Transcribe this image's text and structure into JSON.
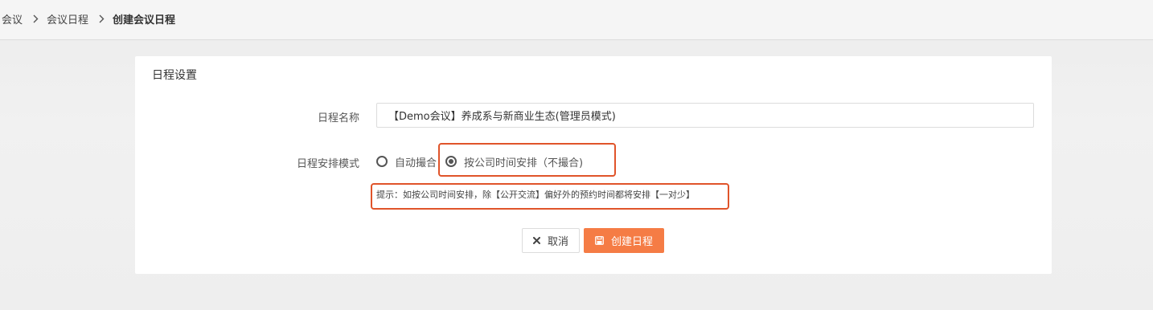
{
  "breadcrumb": {
    "items": [
      "会议",
      "会议日程",
      "创建会议日程"
    ]
  },
  "card": {
    "title": "日程设置"
  },
  "form": {
    "name_label": "日程名称",
    "name_value": "【Demo会议】养成系与新商业生态(管理员模式)",
    "mode_label": "日程安排模式",
    "mode_options": [
      {
        "label": "自动撮合",
        "checked": false
      },
      {
        "label": "按公司时间安排（不撮合)",
        "checked": true
      }
    ],
    "hint": "提示：如按公司时间安排，除【公开交流】偏好外的预约时间都将安排【一对少】"
  },
  "buttons": {
    "cancel": "取消",
    "create": "创建日程"
  },
  "colors": {
    "accent": "#f57c45",
    "highlight": "#e0542a"
  },
  "icons": {
    "separator": "chevron-right-icon",
    "cancel": "close-icon",
    "create": "save-icon",
    "radio": "radio-icon"
  }
}
